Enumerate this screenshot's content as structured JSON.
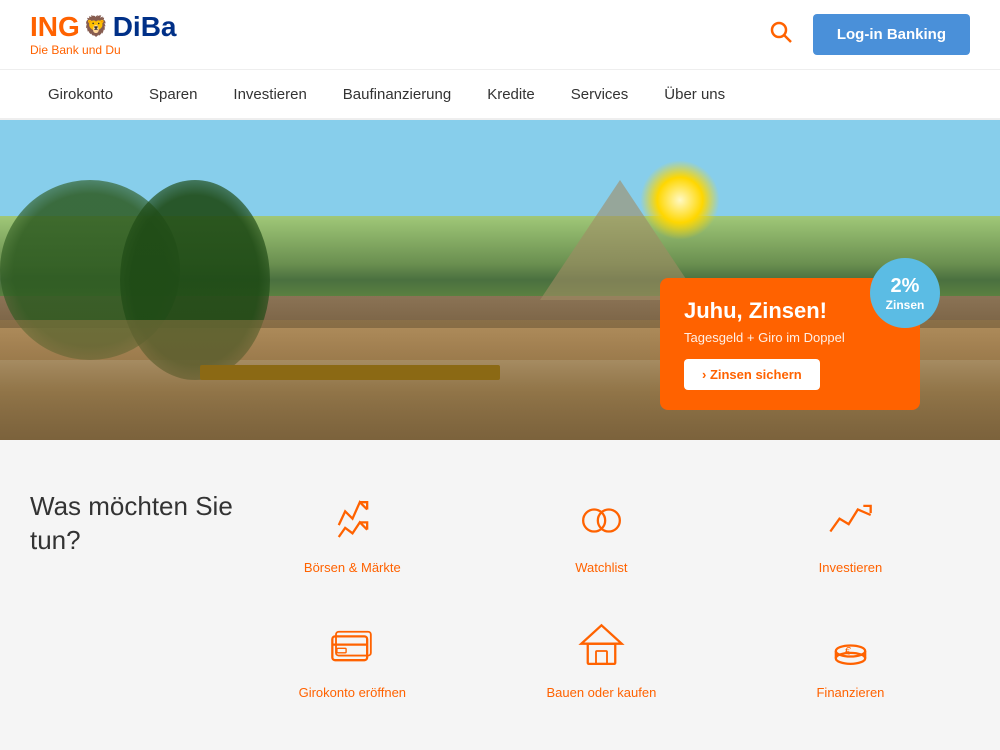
{
  "header": {
    "logo_ing": "ING",
    "logo_diba": "DiBa",
    "logo_sub": "Die Bank und Du",
    "login_label": "Log-in Banking"
  },
  "nav": {
    "items": [
      {
        "label": "Girokonto"
      },
      {
        "label": "Sparen"
      },
      {
        "label": "Investieren"
      },
      {
        "label": "Baufinanzierung"
      },
      {
        "label": "Kredite"
      },
      {
        "label": "Services"
      },
      {
        "label": "Über uns"
      }
    ]
  },
  "hero": {
    "promo": {
      "title": "Juhu, Zinsen!",
      "subtitle": "Tagesgeld + Giro im Doppel",
      "cta": "› Zinsen sichern",
      "badge_percent": "2%",
      "badge_label": "Zinsen"
    }
  },
  "actions": {
    "title_line1": "Was möchten Sie",
    "title_line2": "tun?",
    "items": [
      {
        "label": "Börsen & Märkte",
        "icon": "markets"
      },
      {
        "label": "Watchlist",
        "icon": "watchlist"
      },
      {
        "label": "Investieren",
        "icon": "invest"
      },
      {
        "label": "Girokonto eröffnen",
        "icon": "giro"
      },
      {
        "label": "Bauen oder kaufen",
        "icon": "house"
      },
      {
        "label": "Finanzieren",
        "icon": "finance"
      }
    ]
  }
}
